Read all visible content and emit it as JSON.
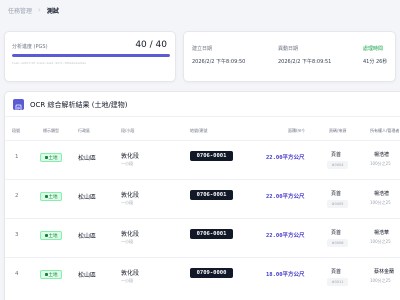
{
  "breadcrumb": {
    "parent": "任務管理",
    "separator": "›",
    "current": "測試"
  },
  "progress": {
    "label": "分析進度 (PGS)",
    "count": "40 / 40",
    "fill_fraction": 1.0,
    "fill_color": "#5b5bd6",
    "task_id": "task-a93d7c0f-b4e9-4a91-9571-388e6a4a2b2e"
  },
  "info": {
    "created_label": "建立日期",
    "created_value": "2026/2/2 下午8:09:50",
    "updated_label": "異動日期",
    "updated_value": "2026/2/2 下午8:09:51",
    "elapsed_label": "處理時間",
    "elapsed_value": "41分 26秒"
  },
  "ocr": {
    "title": "OCR 綜合解析結果 (土地/建物)",
    "icon": "document-icon",
    "columns": [
      "段號",
      "標示類型",
      "行政區",
      "段/小段",
      "地號/建號",
      "面積(m²)",
      "頁碼/來源",
      "所有權人/管理者"
    ],
    "rows": [
      {
        "index": "1",
        "type": "土地",
        "district": "松山區",
        "section": "敦化段",
        "subsection": "一小段",
        "lot": "0706-0001",
        "area": "22.00平方公尺",
        "page": "頁首",
        "page_chip": "#0004",
        "owner": "楊浩禮",
        "owner_sub": "100分之25"
      },
      {
        "index": "2",
        "type": "土地",
        "district": "松山區",
        "section": "敦化段",
        "subsection": "一小段",
        "lot": "0706-0001",
        "area": "22.00平方公尺",
        "page": "頁首",
        "page_chip": "#0005",
        "owner": "楊浩禮",
        "owner_sub": "100分之25"
      },
      {
        "index": "3",
        "type": "土地",
        "district": "松山區",
        "section": "敦化段",
        "subsection": "一小段",
        "lot": "0706-0001",
        "area": "22.00平方公尺",
        "page": "頁首",
        "page_chip": "#0006",
        "owner": "楊浩華",
        "owner_sub": "100分之25"
      },
      {
        "index": "4",
        "type": "土地",
        "district": "松山區",
        "section": "敦化段",
        "subsection": "一小段",
        "lot": "0709-0000",
        "area": "18.00平方公尺",
        "page": "頁首",
        "page_chip": "#0011",
        "owner": "蔡林金蘭",
        "owner_sub": "100分之25"
      }
    ]
  }
}
